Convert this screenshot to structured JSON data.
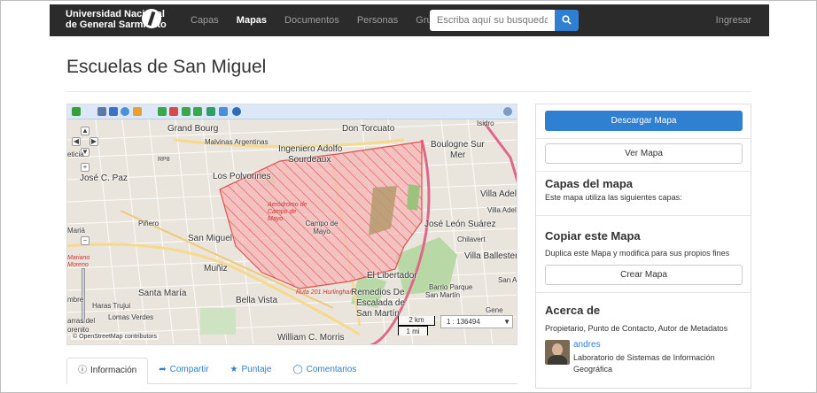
{
  "navbar": {
    "brand_line1": "Universidad Nacional",
    "brand_line2": "de General Sarmiento",
    "links": [
      "Capas",
      "Mapas",
      "Documentos",
      "Personas",
      "Grupos"
    ],
    "active_link": "Mapas",
    "search_placeholder": "Escriba aquí su busqueda ...",
    "login": "Ingresar"
  },
  "page": {
    "title": "Escuelas de San Miguel"
  },
  "map": {
    "labels": {
      "grand_bourg": "Grand Bourg",
      "don_torcuato": "Don Torcuato",
      "malvinas": "Malvinas Argentinas",
      "ingeniero": "Ingeniero Adolfo",
      "sourdeaux": "Sourdeaux",
      "boulogne": "Boulogne Sur",
      "mer": "Mer",
      "jose_c_paz": "José C. Paz",
      "los_polvorines": "Los Polvorines",
      "villa_adelina": "Villa Adelina",
      "aerodromo": "Aeródromo de Campo de Mayo",
      "campo_mayo": "Campo de Mayo",
      "pinero": "Piñero",
      "san_miguel": "San Miguel",
      "jose_leon_suarez": "José León Suárez",
      "chilavert": "Chilavert",
      "villa_ballester": "Villa Ballester",
      "muniz": "Muñiz",
      "el_libertador": "El Libertador",
      "santa_maria": "Santa María",
      "bella_vista": "Bella Vista",
      "remedios": "Remedios De",
      "escalada": "Escalada de",
      "san_martin": "San Martín",
      "barrio_parque": "Barrio Parque",
      "san_martin_sm": "San Martín",
      "harás_trujui": "Haras Trujui",
      "lomas_verdes": "Lomas Verdes",
      "william": "William C. Morris",
      "villa_adelina_2": "Villa Adelina",
      "san_a": "San A",
      "isidro": "Isidro",
      "maria": "Mariá",
      "mariano_moreno": "Mariano Moreno",
      "arras_del": "arras del",
      "orenito": "orenito",
      "mbre": "mbre",
      "ruta8": "RP8",
      "ruta201": "Ruta 201 Hurlingham",
      "gene": "Gene",
      "eticia": "eticia"
    },
    "scale_km": "2 km",
    "scale_mi": "1 mi",
    "scale_value": "1 : 136494",
    "attribution": "© OpenStreetMap contributors"
  },
  "tabs": [
    {
      "label": "Información",
      "icon": "info-icon"
    },
    {
      "label": "Compartir",
      "icon": "share-icon"
    },
    {
      "label": "Puntaje",
      "icon": "star-icon"
    },
    {
      "label": "Comentarios",
      "icon": "comment-icon"
    }
  ],
  "sidebar": {
    "download_button": "Descargar Mapa",
    "view_button": "Ver Mapa",
    "layers_title": "Capas del mapa",
    "layers_text": "Este mapa utiliza las siguientes capas:",
    "copy_title": "Copiar este Mapa",
    "copy_text": "Duplica este Mapa y modifica para sus propios fines",
    "create_button": "Crear Mapa",
    "about_title": "Acerca de",
    "about_text": "Propietario, Punto de Contacto, Autor de Metadatos",
    "user_name": "andres",
    "user_org": "Laboratorio de Sistemas de Información Geográfica"
  },
  "colors": {
    "navbar_bg": "#2b2b2b",
    "accent": "#2f80d1",
    "polygon_fill": "#f4a6a6",
    "polygon_stroke": "#e05050"
  }
}
